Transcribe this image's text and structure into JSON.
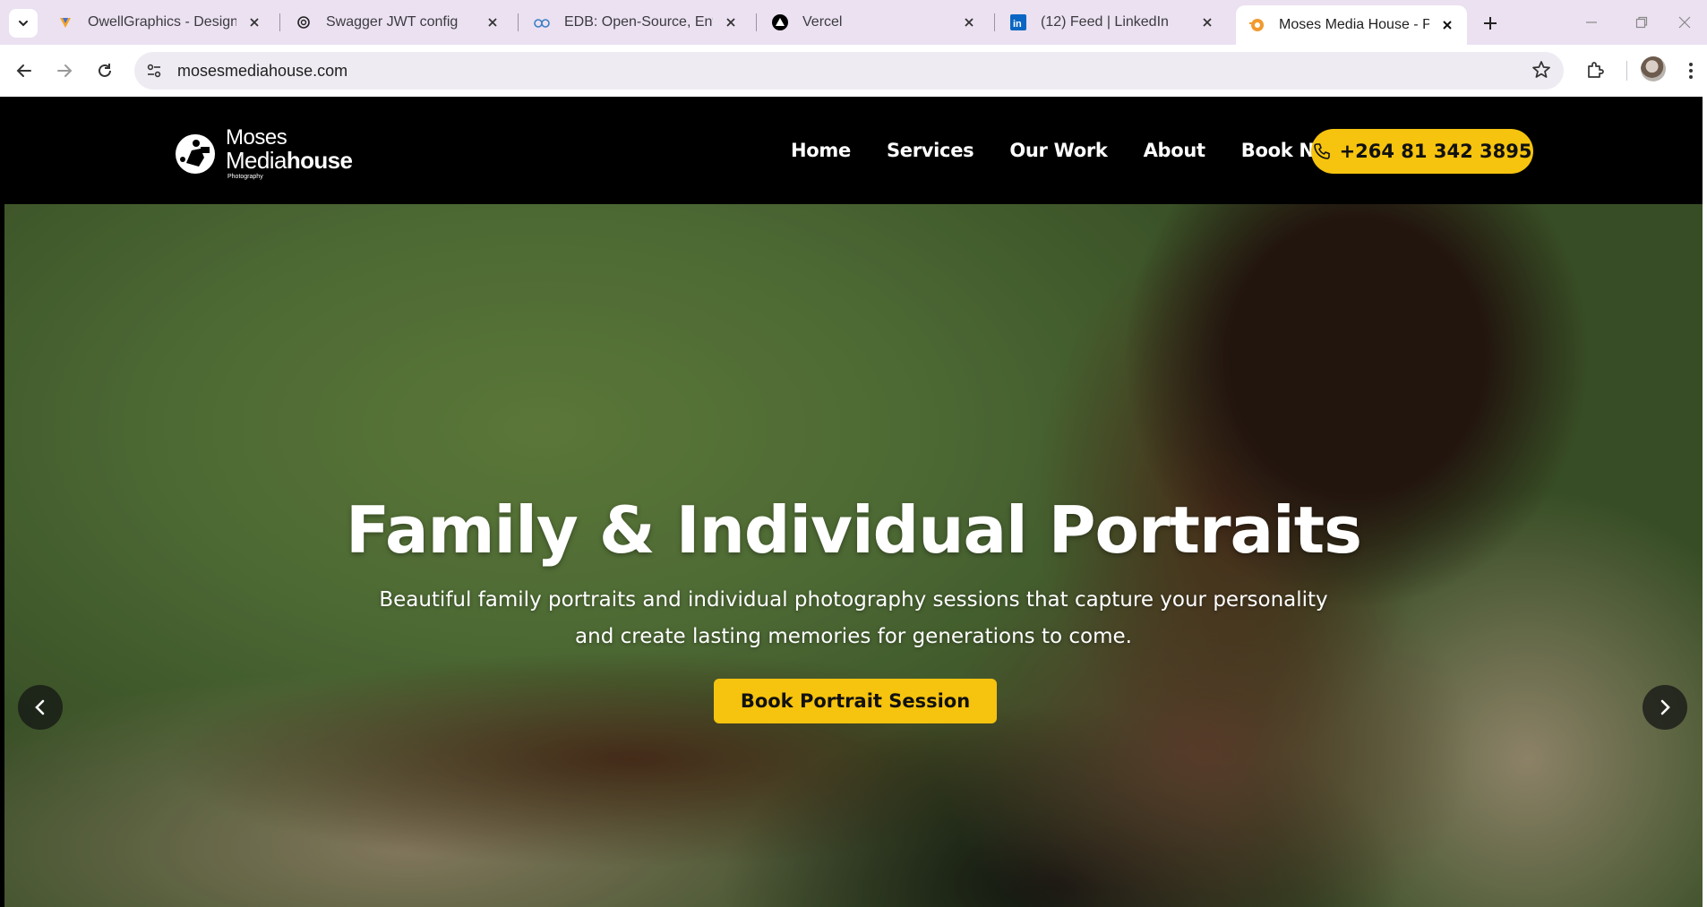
{
  "browser": {
    "tabs": [
      {
        "title": "OwellGraphics - Design So",
        "icon": "owell-favicon"
      },
      {
        "title": "Swagger JWT config",
        "icon": "chatgpt-favicon"
      },
      {
        "title": "EDB: Open-Source, Enterpr",
        "icon": "edb-favicon"
      },
      {
        "title": "Vercel",
        "icon": "vercel-favicon"
      },
      {
        "title": "(12) Feed | LinkedIn",
        "icon": "linkedin-favicon"
      },
      {
        "title": "Moses Media House - Prof",
        "icon": "moses-favicon",
        "active": true
      }
    ],
    "url": "mosesmediahouse.com"
  },
  "site": {
    "logo": {
      "line1": "Moses",
      "line2a": "Media",
      "line2b": "house",
      "line3": "Photography"
    },
    "nav": [
      "Home",
      "Services",
      "Our Work",
      "About",
      "Book Now"
    ],
    "phone": "+264 81 342 3895",
    "hero": {
      "title": "Family & Individual Portraits",
      "subtitle_line1": "Beautiful family portraits and individual photography sessions that capture your personality",
      "subtitle_line2": "and create lasting memories for generations to come.",
      "cta": "Book Portrait Session"
    }
  },
  "colors": {
    "accent": "#f6c30e",
    "header_bg": "#000000",
    "tabstrip_bg": "#ebe1f1"
  }
}
